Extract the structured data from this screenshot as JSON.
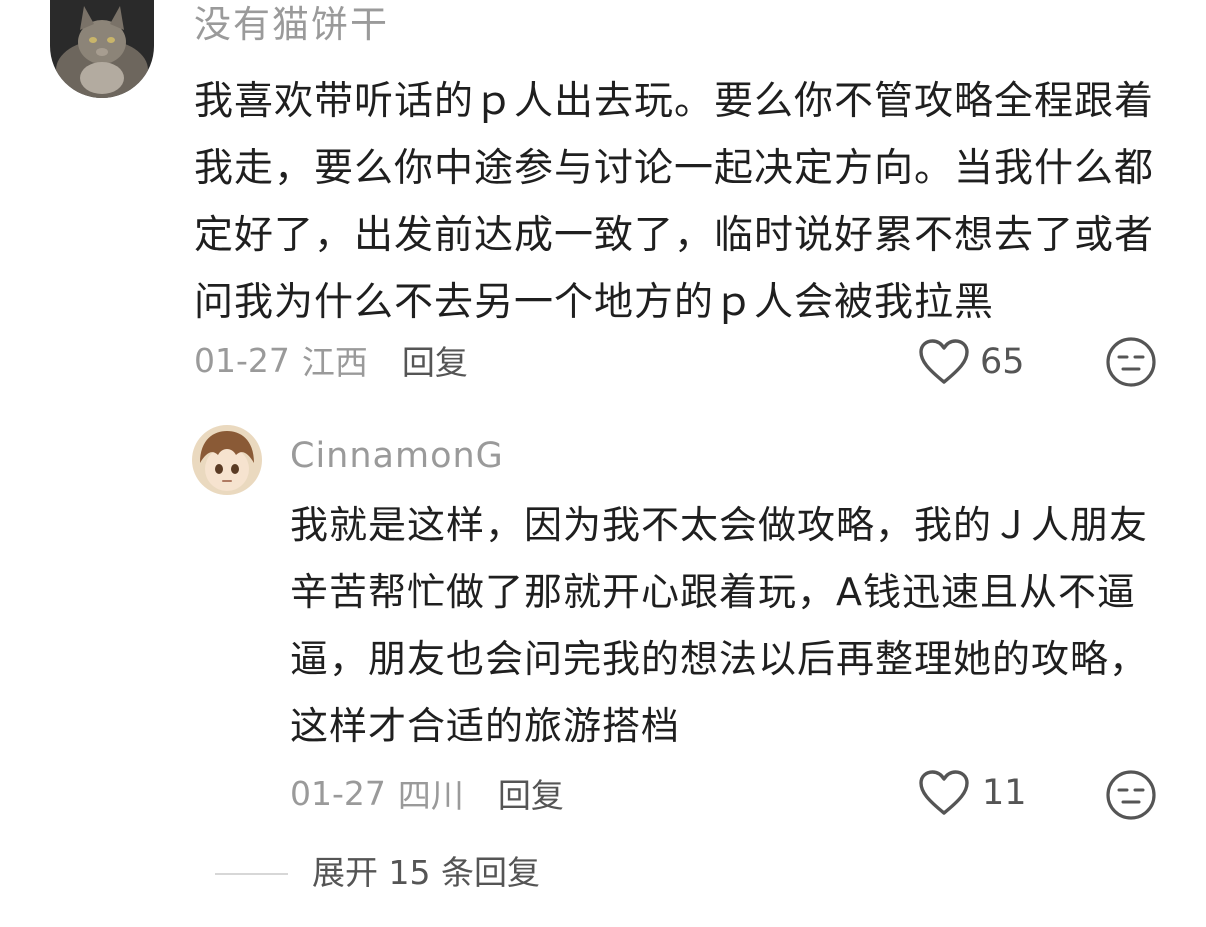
{
  "comments": [
    {
      "username": "没有猫饼干",
      "avatar": "cat-avatar",
      "text": "我喜欢带听话的ｐ人出去玩。要么你不管攻略全程跟着我走，要么你中途参与讨论一起决定方向。当我什么都定好了，出发前达成一致了，临时说好累不想去了或者问我为什么不去另一个地方的ｐ人会被我拉黑",
      "date": "01-27",
      "location": "江西",
      "reply_label": "回复",
      "likes": "65"
    },
    {
      "username": "CinnamonG",
      "avatar": "anime-boy-avatar",
      "text": "我就是这样，因为我不太会做攻略，我的Ｊ人朋友辛苦帮忙做了那就开心跟着玩，A钱迅速且从不逼逼，朋友也会问完我的想法以后再整理她的攻略，这样才合适的旅游搭档",
      "date": "01-27",
      "location": "四川",
      "reply_label": "回复",
      "likes": "11"
    }
  ],
  "expand_label": "展开 15 条回复",
  "colors": {
    "text": "#1f1f1f",
    "muted": "#9a9a9a",
    "action": "#555555"
  }
}
